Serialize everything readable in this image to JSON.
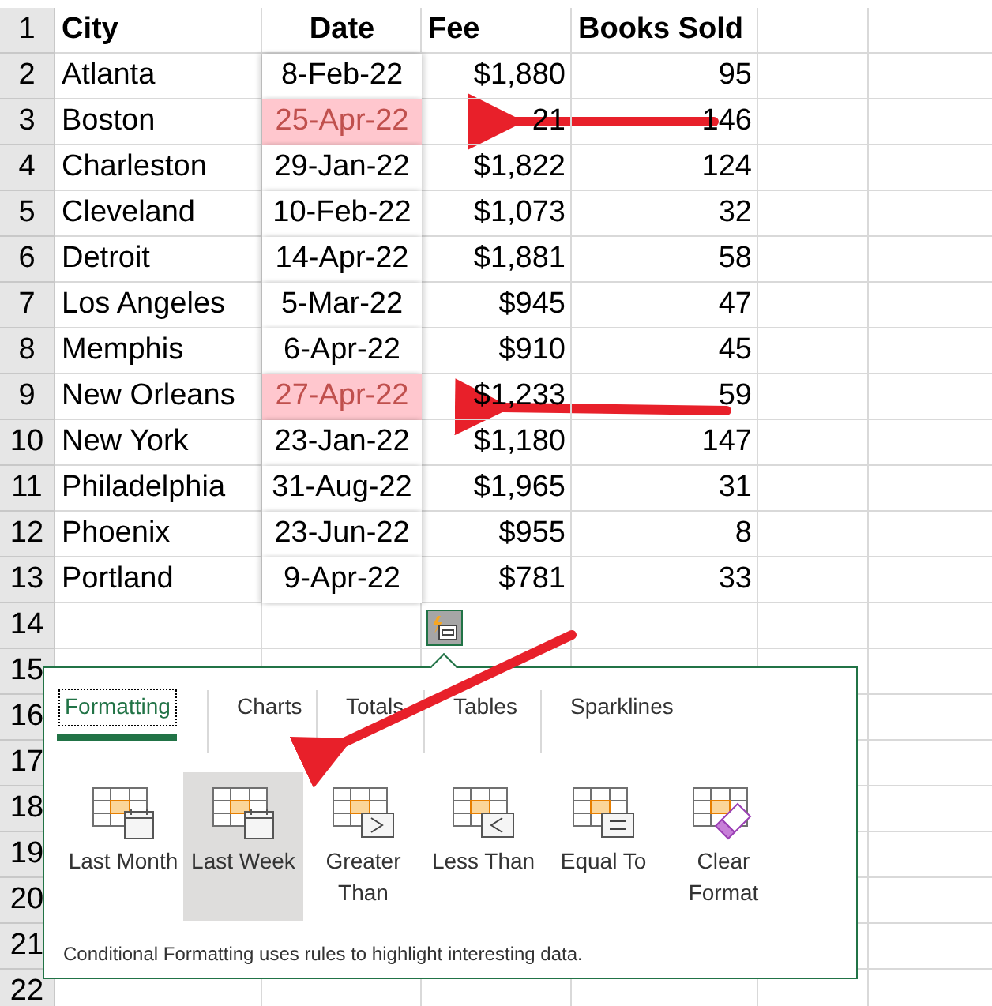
{
  "columns": [
    "City",
    "Date",
    "Fee",
    "Books Sold"
  ],
  "rows": [
    {
      "number": "2",
      "cells": [
        "Atlanta",
        "8-Feb-22",
        "$1,880",
        "95"
      ],
      "highlighted": false
    },
    {
      "number": "3",
      "cells": [
        "Boston",
        "25-Apr-22",
        "21",
        "146"
      ],
      "highlighted": true
    },
    {
      "number": "4",
      "cells": [
        "Charleston",
        "29-Jan-22",
        "$1,822",
        "124"
      ],
      "highlighted": false
    },
    {
      "number": "5",
      "cells": [
        "Cleveland",
        "10-Feb-22",
        "$1,073",
        "32"
      ],
      "highlighted": false
    },
    {
      "number": "6",
      "cells": [
        "Detroit",
        "14-Apr-22",
        "$1,881",
        "58"
      ],
      "highlighted": false
    },
    {
      "number": "7",
      "cells": [
        "Los Angeles",
        "5-Mar-22",
        "$945",
        "47"
      ],
      "highlighted": false
    },
    {
      "number": "8",
      "cells": [
        "Memphis",
        "6-Apr-22",
        "$910",
        "45"
      ],
      "highlighted": false
    },
    {
      "number": "9",
      "cells": [
        "New Orleans",
        "27-Apr-22",
        "$1,233",
        "59"
      ],
      "highlighted": true
    },
    {
      "number": "10",
      "cells": [
        "New York",
        "23-Jan-22",
        "$1,180",
        "147"
      ],
      "highlighted": false
    },
    {
      "number": "11",
      "cells": [
        "Philadelphia",
        "31-Aug-22",
        "$1,965",
        "31"
      ],
      "highlighted": false
    },
    {
      "number": "12",
      "cells": [
        "Phoenix",
        "23-Jun-22",
        "$955",
        "8"
      ],
      "highlighted": false
    },
    {
      "number": "13",
      "cells": [
        "Portland",
        "9-Apr-22",
        "$781",
        "33"
      ],
      "highlighted": false
    }
  ],
  "header_row_number": "1",
  "empty_row_numbers": [
    "14",
    "15",
    "16",
    "17",
    "18",
    "19",
    "20",
    "21",
    "22"
  ],
  "quick_analysis": {
    "tabs": [
      {
        "label": "Formatting",
        "selected": true
      },
      {
        "label": "Charts",
        "selected": false
      },
      {
        "label": "Totals",
        "selected": false
      },
      {
        "label": "Tables",
        "selected": false
      },
      {
        "label": "Sparklines",
        "selected": false
      }
    ],
    "options": [
      {
        "label": "Last Month",
        "kind": "calendar",
        "selected": false
      },
      {
        "label": "Last Week",
        "kind": "calendar",
        "selected": true
      },
      {
        "label": "Greater Than",
        "kind": "greater",
        "selected": false
      },
      {
        "label": "Less Than",
        "kind": "less",
        "selected": false
      },
      {
        "label": "Equal To",
        "kind": "equal",
        "selected": false
      },
      {
        "label": "Clear Format",
        "kind": "eraser",
        "selected": false
      }
    ],
    "description": "Conditional Formatting uses rules to highlight interesting data."
  }
}
